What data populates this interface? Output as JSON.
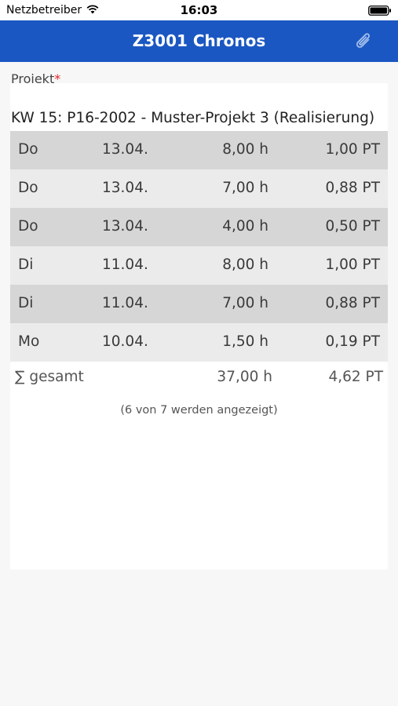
{
  "status_bar": {
    "carrier": "Netzbetreiber",
    "time": "16:03"
  },
  "nav": {
    "title": "Z3001 Chronos",
    "action_icon": "paperclip-icon"
  },
  "form": {
    "label": "Projekt",
    "required_mark": "*"
  },
  "popup": {
    "title": "KW 15: P16-2002 - Muster-Projekt 3 (Realisierung)",
    "rows": [
      {
        "day": "Do",
        "date": "13.04.",
        "hours": "8,00 h",
        "pt": "1,00 PT"
      },
      {
        "day": "Do",
        "date": "13.04.",
        "hours": "7,00 h",
        "pt": "0,88 PT"
      },
      {
        "day": "Do",
        "date": "13.04.",
        "hours": "4,00 h",
        "pt": "0,50 PT"
      },
      {
        "day": "Di",
        "date": "11.04.",
        "hours": "8,00 h",
        "pt": "1,00 PT"
      },
      {
        "day": "Di",
        "date": "11.04.",
        "hours": "7,00 h",
        "pt": "0,88 PT"
      },
      {
        "day": "Mo",
        "date": "10.04.",
        "hours": "1,50 h",
        "pt": "0,19 PT"
      }
    ],
    "total": {
      "label": "∑ gesamt",
      "hours": "37,00 h",
      "pt": "4,62 PT"
    },
    "footnote": "(6 von 7 werden angezeigt)"
  },
  "colors": {
    "nav_bg": "#1b57c2",
    "row_dark": "#d6d6d6",
    "row_light": "#ebebeb",
    "required": "#e0242b"
  }
}
